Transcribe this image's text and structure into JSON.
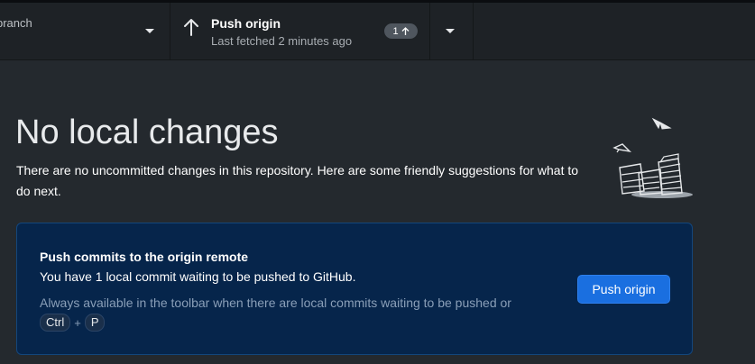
{
  "toolbar": {
    "branch_label": "branch",
    "push": {
      "title": "Push origin",
      "subtitle": "Last fetched 2 minutes ago",
      "ahead_count": "1"
    }
  },
  "main": {
    "heading": "No local changes",
    "description": "There are no uncommitted changes in this repository. Here are some friendly suggestions for what to do next.",
    "card": {
      "title": "Push commits to the origin remote",
      "text": "You have 1 local commit waiting to be pushed to GitHub.",
      "hint": "Always available in the toolbar when there are local commits waiting to be pushed or",
      "shortcut": {
        "key1": "Ctrl",
        "plus": "+",
        "key2": "P"
      },
      "button_label": "Push origin"
    }
  },
  "colors": {
    "background": "#24292e",
    "toolbar": "#1e2226",
    "card_background": "#06254b",
    "card_border": "#13467c",
    "button": "#1a6fe0"
  },
  "icons": [
    "arrow-up-icon",
    "chevron-down-icon",
    "no-changes-illustration"
  ]
}
